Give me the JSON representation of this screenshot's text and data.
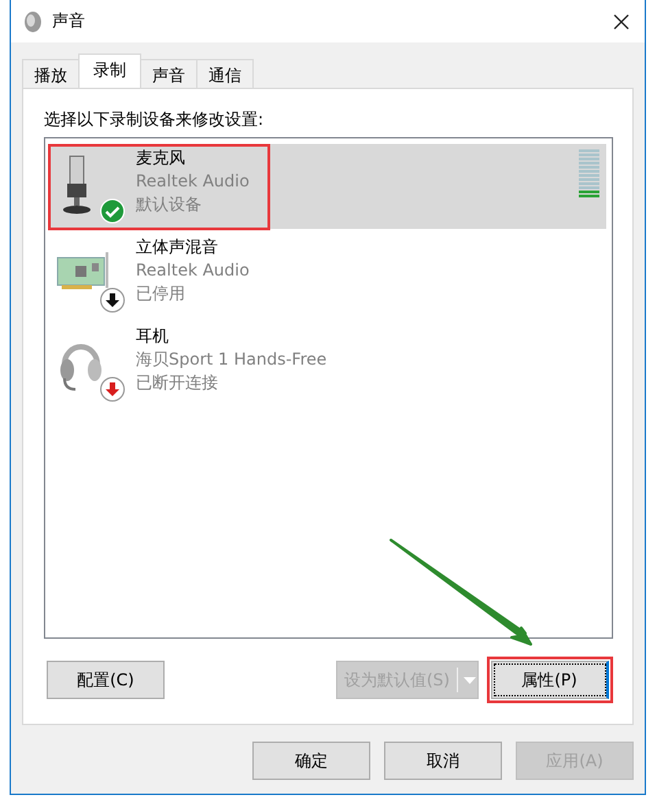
{
  "window": {
    "title": "声音"
  },
  "tabs": [
    {
      "label": "播放",
      "selected": false
    },
    {
      "label": "录制",
      "selected": true
    },
    {
      "label": "声音",
      "selected": false
    },
    {
      "label": "通信",
      "selected": false
    }
  ],
  "instruction": "选择以下录制设备来修改设置:",
  "devices": [
    {
      "kind": "microphone",
      "name": "麦克风",
      "driver": "Realtek Audio",
      "status": "默认设备",
      "is_default": true,
      "disabled": false,
      "connected": true,
      "selected": true,
      "highlighted": true,
      "level": 0.17
    },
    {
      "kind": "sound-card",
      "name": "立体声混音",
      "driver": "Realtek Audio",
      "status": "已停用",
      "is_default": false,
      "disabled": true,
      "connected": true,
      "selected": false,
      "highlighted": false
    },
    {
      "kind": "headset",
      "name": "耳机",
      "driver": "海贝Sport 1 Hands-Free",
      "status": "已断开连接",
      "is_default": false,
      "disabled": false,
      "connected": false,
      "selected": false,
      "highlighted": false
    }
  ],
  "panel_buttons": [
    {
      "kind": "plain",
      "label": "配置(C)",
      "disabled": false,
      "highlighted": false
    },
    {
      "kind": "split",
      "label": "设为默认值(S)",
      "disabled": true,
      "highlighted": false
    },
    {
      "kind": "plain",
      "label": "属性(P)",
      "disabled": false,
      "highlighted": true
    }
  ],
  "annotation_arrow": true,
  "dialog_buttons": [
    {
      "label": "确定",
      "disabled": false
    },
    {
      "label": "取消",
      "disabled": false
    },
    {
      "label": "应用(A)",
      "disabled": true
    }
  ]
}
